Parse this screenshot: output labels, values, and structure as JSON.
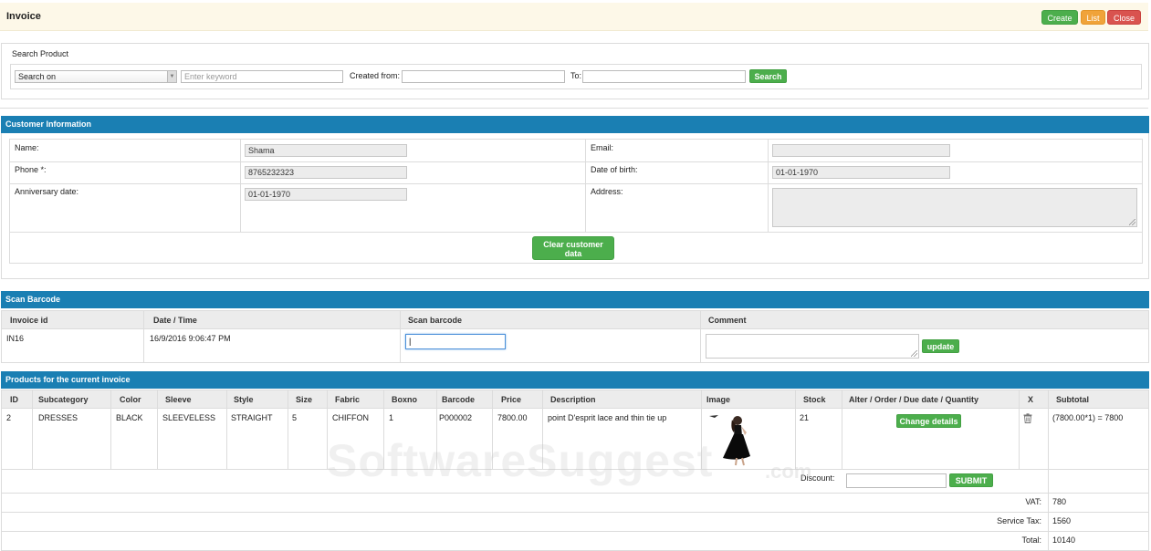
{
  "header": {
    "title": "Invoice",
    "create_label": "Create",
    "list_label": "List",
    "close_label": "Close"
  },
  "search": {
    "section_label": "Search Product",
    "search_on_value": "Search on",
    "keyword_placeholder": "Enter keyword",
    "created_from_label": "Created from:",
    "to_label": "To:",
    "search_button": "Search"
  },
  "customer": {
    "section_title": "Customer Information",
    "name_label": "Name:",
    "name_value": "Shama",
    "email_label": "Email:",
    "email_value": "",
    "phone_label": "Phone *:",
    "phone_value": "8765232323",
    "dob_label": "Date of birth:",
    "dob_value": "01-01-1970",
    "anniversary_label": "Anniversary date:",
    "anniversary_value": "01-01-1970",
    "address_label": "Address:",
    "address_value": "",
    "clear_button_line1": "Clear customer",
    "clear_button_line2": "data"
  },
  "scan": {
    "section_title": "Scan Barcode",
    "headers": [
      "Invoice id",
      "Date / Time",
      "Scan barcode",
      "Comment"
    ],
    "invoice_id": "IN16",
    "date_time": "16/9/2016 9:06:47 PM",
    "barcode_value": "",
    "comment_value": "",
    "update_button": "update"
  },
  "products": {
    "section_title": "Products for the current invoice",
    "headers": [
      "ID",
      "Subcategory",
      "Color",
      "Sleeve",
      "Style",
      "Size",
      "Fabric",
      "Boxno",
      "Barcode",
      "Price",
      "Description",
      "Image",
      "Stock",
      "Alter / Order / Due date / Quantity",
      "X",
      "Subtotal"
    ],
    "rows": [
      {
        "id": "2",
        "subcategory": "DRESSES",
        "color": "BLACK",
        "sleeve": "SLEEVELESS",
        "style": "STRAIGHT",
        "size": "5",
        "fabric": "CHIFFON",
        "boxno": "1",
        "barcode": "P000002",
        "price": "7800.00",
        "description": "point D'esprit lace and thin tie up",
        "stock": "21",
        "action_button": "Change details",
        "subtotal": "(7800.00*1) = 7800"
      }
    ],
    "discount_label": "Discount:",
    "discount_value": "",
    "submit_button": "SUBMIT",
    "vat_label": "VAT:",
    "vat_value": "780",
    "service_tax_label": "Service Tax:",
    "service_tax_value": "1560",
    "total_label": "Total:",
    "total_value": "10140"
  },
  "watermark": {
    "text": "SoftwareSuggest",
    "suffix": ".com"
  },
  "icons": {
    "trash": "trash-icon",
    "dropdown": "chevron-down-icon"
  },
  "colors": {
    "section_header": "#1a7fb3",
    "button_green": "#4cae4c",
    "button_orange": "#f0a33a",
    "button_red": "#d9534f",
    "header_bg": "#fdf8e8"
  }
}
